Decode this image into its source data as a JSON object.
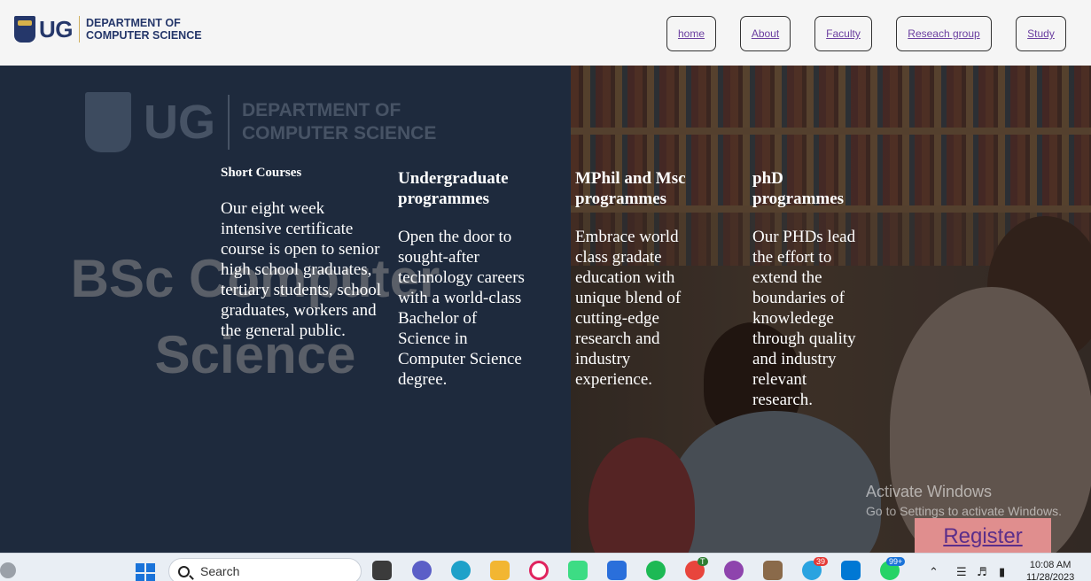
{
  "header": {
    "logo_ug": "UG",
    "logo_dept_line1": "DEPARTMENT OF",
    "logo_dept_line2": "COMPUTER SCIENCE",
    "nav": [
      "home",
      "About",
      "Faculty",
      "Reseach group",
      "Study"
    ]
  },
  "hero": {
    "watermark_ug": "UG",
    "watermark_dept_line1": "DEPARTMENT OF",
    "watermark_dept_line2": "COMPUTER SCIENCE",
    "watermark_title": "BSc Computer Science"
  },
  "programs": [
    {
      "title": "Short Courses",
      "text": "Our eight week intensive certificate course is open to senior high school graduates, tertiary students, school graduates, workers and the general public."
    },
    {
      "title": "Undergraduate programmes",
      "text": "Open the door to sought-after technology careers with a world-class Bachelor of Science in Computer Science degree."
    },
    {
      "title": "MPhil and Msc programmes",
      "text": "Embrace world class gradate education with unique blend of cutting-edge research and industry experience."
    },
    {
      "title": "phD programmes",
      "text": "Our PHDs lead the effort to extend the boundaries of knowledege through quality and industry relevant research."
    }
  ],
  "register_label": "Register",
  "activation": {
    "line1": "Activate Windows",
    "line2": "Go to Settings to activate Windows."
  },
  "taskbar": {
    "search_placeholder": "Search",
    "chrome_badge": "T",
    "telegram_badge": "39",
    "whatsapp_badge": "99+",
    "time": "10:08 AM",
    "date": "11/28/2023"
  },
  "colors": {
    "header_bg": "#f5f5f5",
    "hero_bg": "#1e2a3d",
    "brand_blue": "#25376a",
    "nav_link": "#6b3fa0",
    "register_bg": "#e08e8e"
  }
}
